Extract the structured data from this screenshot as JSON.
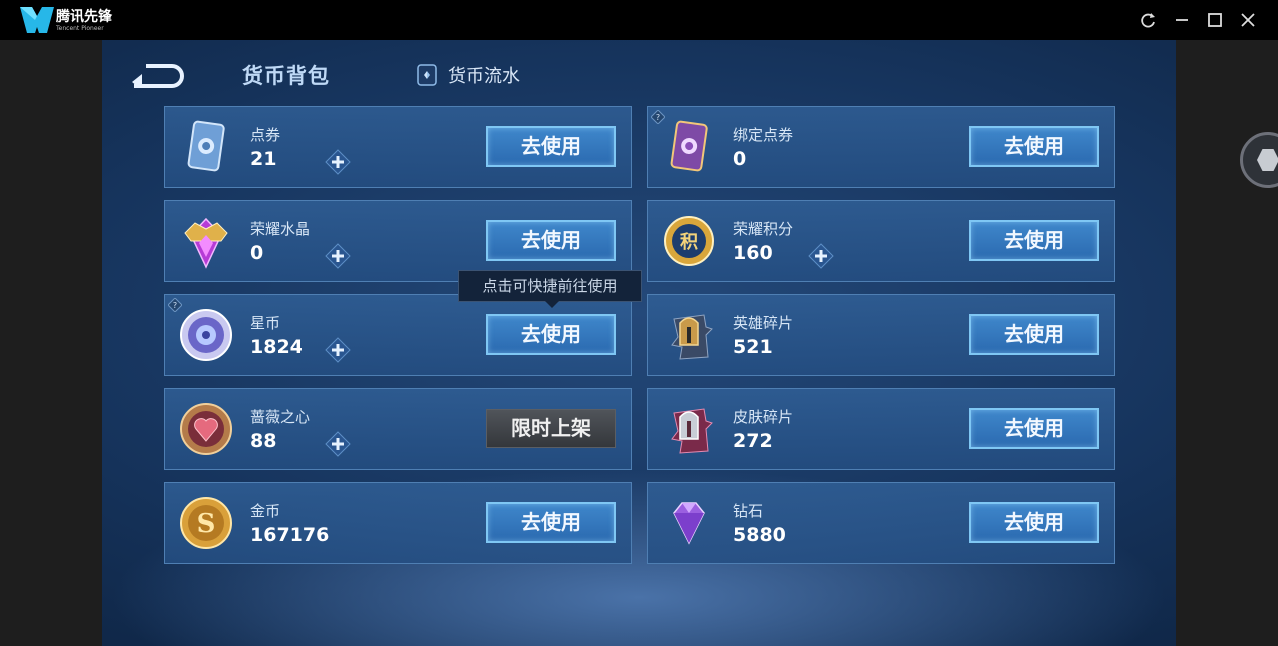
{
  "window": {
    "app_name": "腾讯先锋",
    "app_subtitle": "Tencent Pioneer",
    "controls": [
      "refresh-icon",
      "minimize-icon",
      "maximize-icon",
      "close-icon"
    ]
  },
  "header": {
    "title": "货币背包",
    "flow_tab": "货币流水"
  },
  "tooltip": "点击可快捷前往使用",
  "currencies": [
    {
      "name": "点券",
      "amount": "21",
      "button": "去使用",
      "icon": "voucher-icon"
    },
    {
      "name": "绑定点券",
      "amount": "0",
      "button": "去使用",
      "icon": "bound-voucher-icon"
    },
    {
      "name": "荣耀水晶",
      "amount": "0",
      "button": "去使用",
      "icon": "glory-crystal-icon"
    },
    {
      "name": "荣耀积分",
      "amount": "160",
      "button": "去使用",
      "icon": "glory-points-icon"
    },
    {
      "name": "星币",
      "amount": "1824",
      "button": "去使用",
      "icon": "star-coin-icon"
    },
    {
      "name": "英雄碎片",
      "amount": "521",
      "button": "去使用",
      "icon": "hero-fragment-icon"
    },
    {
      "name": "蔷薇之心",
      "amount": "88",
      "button": "限时上架",
      "icon": "rose-heart-icon"
    },
    {
      "name": "皮肤碎片",
      "amount": "272",
      "button": "去使用",
      "icon": "skin-fragment-icon"
    },
    {
      "name": "金币",
      "amount": "167176",
      "button": "去使用",
      "icon": "gold-coin-icon"
    },
    {
      "name": "钻石",
      "amount": "5880",
      "button": "去使用",
      "icon": "diamond-icon"
    }
  ],
  "colors": {
    "background": "#16345d",
    "card_border": "#4f7fb3",
    "button": "#3f87cb",
    "button_border": "#7fc7f4",
    "disabled_button": "#404448"
  }
}
